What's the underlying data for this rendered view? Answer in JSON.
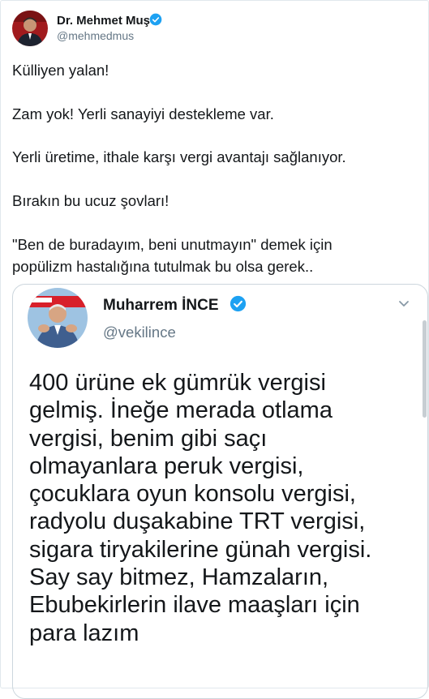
{
  "author": {
    "name": "Dr. Mehmet Muş",
    "handle": "@mehmedmus",
    "verified_icon": "verified-badge-icon"
  },
  "tweet": {
    "lines": [
      "Külliyen yalan!",
      "Zam yok! Yerli sanayiyi destekleme var.",
      "Yerli üretime, ithale karşı vergi avantajı sağlanıyor.",
      "Bırakın bu ucuz şovları!",
      "\"Ben de buradayım, beni unutmayın\" demek için",
      "popülizm hastalığına tutulmak bu olsa gerek.."
    ]
  },
  "quoted_tweet": {
    "name": "Muharrem İNCE",
    "handle": "@vekilince",
    "lines": [
      "400 ürüne ek gümrük vergisi",
      "gelmiş. İneğe merada otlama",
      "vergisi, benim gibi saçı",
      "olmayanlara peruk vergisi,",
      "çocuklara oyun konsolu vergisi,",
      "radyolu duşakabine TRT vergisi,",
      "sigara tiryakilerine günah vergisi.",
      "Say say bitmez, Hamzaların,",
      "Ebubekirlerin ilave maaşları için",
      "para lazım"
    ]
  },
  "colors": {
    "verified_blue": "#1da1f2",
    "handle_gray": "#657786",
    "text": "#14171a",
    "border": "#ccd6dd"
  }
}
